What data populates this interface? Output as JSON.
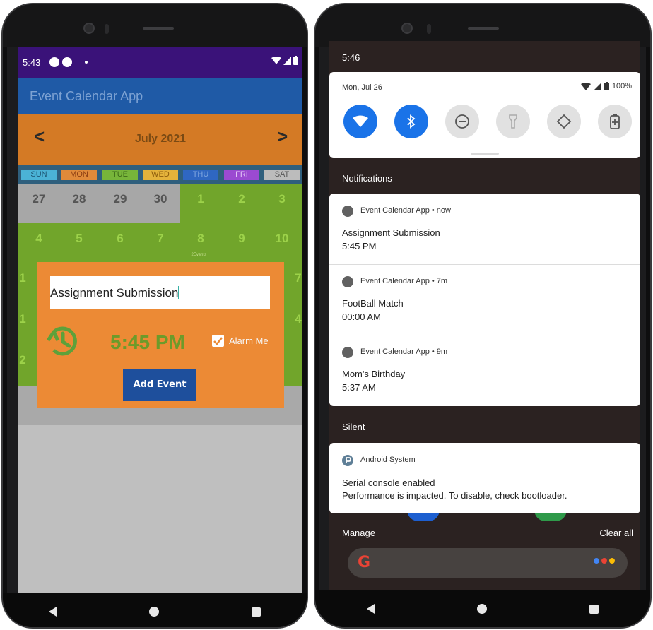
{
  "left_phone": {
    "status": {
      "time": "5:43"
    },
    "app_title": "Event Calendar App",
    "calendar": {
      "prev": "<",
      "next": ">",
      "month": "July 2021",
      "weekdays": [
        {
          "label": "SUN",
          "bg": "#4bb3d6",
          "fg": "#1d5573"
        },
        {
          "label": "MON",
          "bg": "#e08a3a",
          "fg": "#8a3d13"
        },
        {
          "label": "TUE",
          "bg": "#77b53a",
          "fg": "#3d6a19"
        },
        {
          "label": "WED",
          "bg": "#e4b23b",
          "fg": "#8c5b0c"
        },
        {
          "label": "THU",
          "bg": "#2f67c2",
          "fg": "#7fa6e0"
        },
        {
          "label": "FRI",
          "bg": "#9b4ad1",
          "fg": "#e4c7f6"
        },
        {
          "label": "SAT",
          "bg": "#bcbcbc",
          "fg": "#555555"
        }
      ],
      "week1": [
        "27",
        "28",
        "29",
        "30",
        "1",
        "2",
        "3"
      ],
      "week2": [
        "4",
        "5",
        "6",
        "7",
        "8",
        "9",
        "10"
      ],
      "events_note": "2Events :",
      "left_col_peek": [
        "1",
        "1",
        "2"
      ],
      "right_col_peek": [
        "7",
        "4"
      ]
    },
    "dialog": {
      "event_name": "Assignment Submission",
      "time": "5:45 PM",
      "alarm_label": "Alarm Me",
      "alarm_checked": true,
      "add_button": "Add Event"
    }
  },
  "right_phone": {
    "status": {
      "time": "5:46"
    },
    "quick_settings": {
      "date": "Mon, Jul 26",
      "battery": "100%",
      "tiles": [
        "wifi-icon",
        "bluetooth-icon",
        "do-not-disturb-icon",
        "flashlight-icon",
        "auto-rotate-icon",
        "battery-saver-icon"
      ]
    },
    "notifications_header": "Notifications",
    "notifications": [
      {
        "app": "Event Calendar App • now",
        "title": "Assignment Submission",
        "text": "5:45 PM"
      },
      {
        "app": "Event Calendar App • 7m",
        "title": "FootBall Match",
        "text": "00:00 AM"
      },
      {
        "app": "Event Calendar App • 9m",
        "title": "Mom's Birthday",
        "text": "5:37 AM"
      }
    ],
    "silent_header": "Silent",
    "silent_notification": {
      "app": "Android System",
      "title": "Serial console enabled",
      "text": "Performance is impacted. To disable, check bootloader."
    },
    "manage": "Manage",
    "clear_all": "Clear all",
    "search_logo": "G"
  },
  "colors": {
    "status_bar": "#3a1279",
    "app_bar": "#1f5aa6",
    "month_bar": "#d47a25",
    "calendar_green": "#71a52b",
    "dialog": "#ec8a35",
    "add_button": "#1e4f9c",
    "qs_active": "#1a73e8"
  }
}
